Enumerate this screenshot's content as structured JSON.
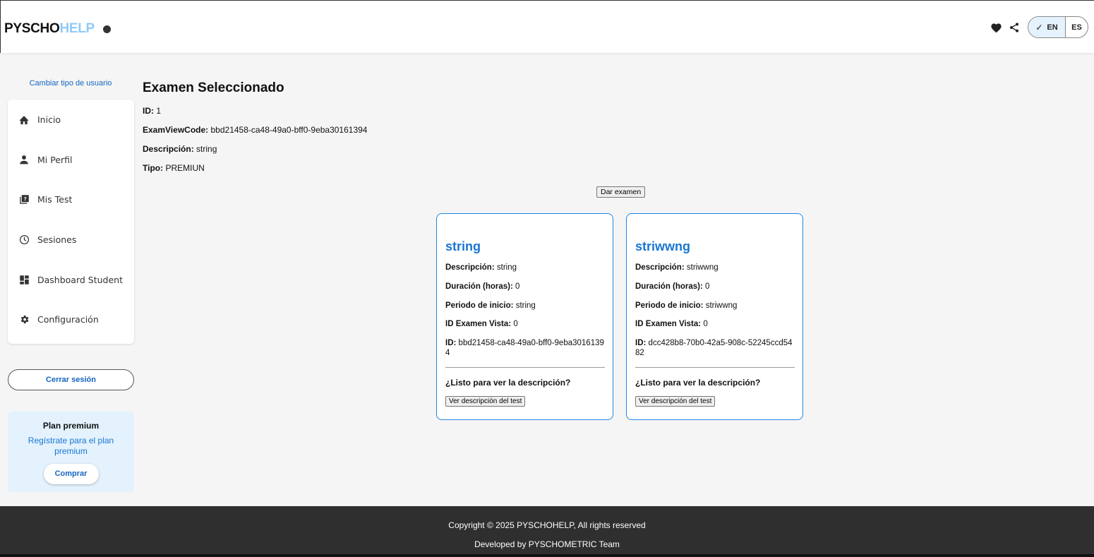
{
  "header": {
    "logo_part1": "PYSCHO",
    "logo_part2": "HELP",
    "lang_active": "EN",
    "lang_other": "ES",
    "accent_color": "#90caf9"
  },
  "sidebar": {
    "change_user": "Cambiar tipo de usuario",
    "items": [
      {
        "label": "Inicio",
        "icon": "home-icon"
      },
      {
        "label": "Mi Perfil",
        "icon": "person-icon"
      },
      {
        "label": "Mis Test",
        "icon": "quiz-icon"
      },
      {
        "label": "Sesiones",
        "icon": "clock-icon"
      },
      {
        "label": "Dashboard Student",
        "icon": "dashboard-icon"
      },
      {
        "label": "Configuración",
        "icon": "gear-icon"
      }
    ],
    "logout": "Cerrar sesión",
    "premium": {
      "title": "Plan premium",
      "description": "Regístrate para el plan premium",
      "button": "Comprar"
    }
  },
  "main": {
    "title": "Examen Seleccionado",
    "id_label": "ID:",
    "id_value": "1",
    "code_label": "ExamViewCode:",
    "code_value": "bbd21458-ca48-49a0-bff0-9eba30161394",
    "desc_label": "Descripción:",
    "desc_value": "string",
    "type_label": "Tipo:",
    "type_value": "PREMIUN",
    "take_button": "Dar examen"
  },
  "cards_labels": {
    "desc": "Descripción:",
    "duration": "Duración (horas):",
    "start": "Periodo de inicio:",
    "view_id": "ID Examen Vista:",
    "id": "ID:",
    "question": "¿Listo para ver la descripción?",
    "button": "Ver descripción del test"
  },
  "cards": [
    {
      "title": "string",
      "desc": "string",
      "duration": "0",
      "start": "string",
      "view_id": "0",
      "id": "bbd21458-ca48-49a0-bff0-9eba30161394"
    },
    {
      "title": "striwwng",
      "desc": "striwwng",
      "duration": "0",
      "start": "striwwng",
      "view_id": "0",
      "id": "dcc428b8-70b0-42a5-908c-52245ccd5482"
    }
  ],
  "footer": {
    "copyright": "Copyright © 2025 PYSCHOHELP, All rights reserved",
    "developed": "Developed by PYSCHOMETRIC Team"
  }
}
